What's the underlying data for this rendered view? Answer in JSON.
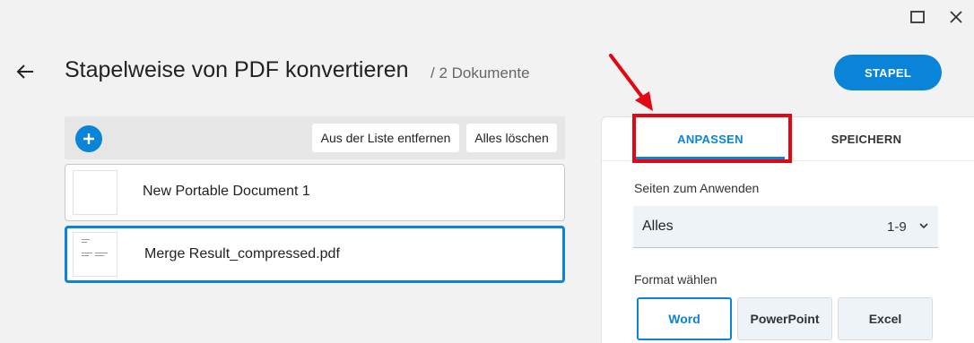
{
  "header": {
    "title": "Stapelweise von PDF konvertieren",
    "subtitle": "/ 2 Dokumente",
    "action_label": "STAPEL"
  },
  "window_controls": {
    "maximize_icon": "maximize-icon",
    "close_icon": "close-icon"
  },
  "toolbar": {
    "remove_label": "Aus der Liste entfernen",
    "clear_label": "Alles löschen"
  },
  "documents": [
    {
      "name": "New Portable Document 1",
      "selected": false
    },
    {
      "name": "Merge Result_compressed.pdf",
      "selected": true
    }
  ],
  "panel": {
    "tabs": [
      {
        "label": "ANPASSEN",
        "active": true
      },
      {
        "label": "SPEICHERN",
        "active": false
      }
    ],
    "pages_label": "Seiten zum Anwenden",
    "pages_select": {
      "value": "Alles",
      "range": "1-9"
    },
    "format_label": "Format wählen",
    "formats": [
      {
        "label": "Word",
        "selected": true
      },
      {
        "label": "PowerPoint",
        "selected": false
      },
      {
        "label": "Excel",
        "selected": false
      }
    ]
  },
  "colors": {
    "accent": "#0a84d8",
    "annotation": "#e30613",
    "background": "#f2f2f2"
  }
}
